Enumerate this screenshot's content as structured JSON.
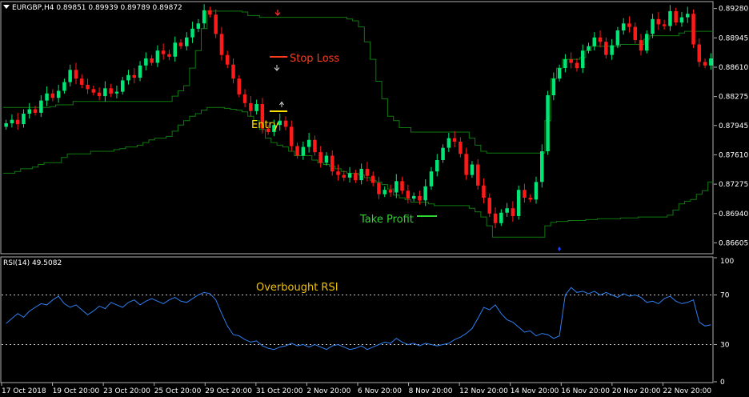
{
  "header": {
    "symbol_line": "EURGBP,H4  0.89851 0.89939 0.89789 0.89872",
    "rsi_label": "RSI(14) 49.5082"
  },
  "annotations": {
    "stop_loss": "Stop Loss",
    "entry": "Entry",
    "take_profit": "Take Profit",
    "overbought": "Overbought RSI"
  },
  "colors": {
    "background": "#000000",
    "bull": "#00e676",
    "bear": "#ff1a1a",
    "channel": "#0f7a0f",
    "rsi": "#2f7ff0",
    "stop_loss": "#ff3b1e",
    "entry": "#ffe100",
    "take_profit": "#2fd42f",
    "overbought": "#f2c200"
  },
  "chart_data": [
    {
      "type": "candlestick",
      "symbol": "EURGBP",
      "timeframe": "H4",
      "ylim": [
        0.8649,
        0.8935
      ],
      "yticks": [
        "0.89280",
        "0.88945",
        "0.88610",
        "0.88275",
        "0.87945",
        "0.87610",
        "0.87275",
        "0.86940",
        "0.86605"
      ],
      "xticks": [
        "17 Oct 2018",
        "19 Oct 20:00",
        "23 Oct 20:00",
        "25 Oct 20:00",
        "29 Oct 20:00",
        "31 Oct 20:00",
        "2 Nov 20:00",
        "6 Nov 20:00",
        "8 Nov 20:00",
        "12 Nov 20:00",
        "14 Nov 20:00",
        "16 Nov 20:00",
        "20 Nov 20:00",
        "22 Nov 20:00"
      ],
      "close": [
        0.8797,
        0.8801,
        0.8796,
        0.8808,
        0.8813,
        0.8809,
        0.8823,
        0.8831,
        0.8826,
        0.8834,
        0.8844,
        0.8858,
        0.8848,
        0.8841,
        0.8836,
        0.8832,
        0.8828,
        0.8837,
        0.8831,
        0.8833,
        0.8846,
        0.8852,
        0.8849,
        0.8863,
        0.8871,
        0.8866,
        0.888,
        0.8876,
        0.8873,
        0.8889,
        0.8885,
        0.8895,
        0.8905,
        0.8911,
        0.8926,
        0.8921,
        0.8899,
        0.8875,
        0.8864,
        0.8848,
        0.883,
        0.882,
        0.8811,
        0.8819,
        0.8791,
        0.8787,
        0.8795,
        0.88,
        0.8793,
        0.8771,
        0.876,
        0.877,
        0.8778,
        0.8764,
        0.8752,
        0.876,
        0.8742,
        0.8738,
        0.8735,
        0.874,
        0.8732,
        0.8745,
        0.8737,
        0.8729,
        0.8716,
        0.8721,
        0.8718,
        0.8731,
        0.872,
        0.8711,
        0.8714,
        0.8709,
        0.8725,
        0.8742,
        0.8755,
        0.8769,
        0.878,
        0.8776,
        0.8762,
        0.8738,
        0.875,
        0.8726,
        0.8712,
        0.8694,
        0.8683,
        0.8695,
        0.87,
        0.8691,
        0.8721,
        0.8712,
        0.871,
        0.873,
        0.8765,
        0.8829,
        0.8848,
        0.886,
        0.887,
        0.8866,
        0.886,
        0.888,
        0.8885,
        0.8895,
        0.889,
        0.8875,
        0.8886,
        0.8903,
        0.8911,
        0.8907,
        0.8892,
        0.888,
        0.8899,
        0.8916,
        0.891,
        0.8908,
        0.8925,
        0.8912,
        0.8918,
        0.8922,
        0.8887,
        0.8867,
        0.8863,
        0.8871
      ],
      "channel_upper": [
        0.8815,
        0.8815,
        0.8815,
        0.8815,
        0.8815,
        0.8815,
        0.8815,
        0.8815,
        0.8816,
        0.8818,
        0.8818,
        0.8818,
        0.8822,
        0.8822,
        0.8822,
        0.8822,
        0.8822,
        0.8822,
        0.8822,
        0.8822,
        0.8822,
        0.8822,
        0.8822,
        0.8822,
        0.8822,
        0.8822,
        0.8822,
        0.8822,
        0.8822,
        0.8828,
        0.8834,
        0.884,
        0.886,
        0.888,
        0.8905,
        0.8925,
        0.8925,
        0.8925,
        0.8925,
        0.8925,
        0.8925,
        0.8924,
        0.892,
        0.892,
        0.8918,
        0.8918,
        0.8918,
        0.8918,
        0.8918,
        0.8918,
        0.8918,
        0.8918,
        0.8918,
        0.8918,
        0.8918,
        0.8918,
        0.8918,
        0.8918,
        0.8918,
        0.8916,
        0.8914,
        0.8907,
        0.889,
        0.887,
        0.8845,
        0.8825,
        0.8805,
        0.88,
        0.8792,
        0.8792,
        0.8787,
        0.8787,
        0.8787,
        0.8787,
        0.8787,
        0.8787,
        0.8787,
        0.8787,
        0.8787,
        0.8787,
        0.878,
        0.8772,
        0.8765,
        0.8763,
        0.8763,
        0.8763,
        0.8763,
        0.8763,
        0.8763,
        0.8763,
        0.8763,
        0.8763,
        0.8763,
        0.88,
        0.8848,
        0.886,
        0.887,
        0.887,
        0.887,
        0.8872,
        0.888,
        0.8885,
        0.8885,
        0.8885,
        0.8885,
        0.8885,
        0.8887,
        0.8887,
        0.8887,
        0.8887,
        0.8893,
        0.8897,
        0.8897,
        0.8897,
        0.8897,
        0.8897,
        0.89,
        0.8902,
        0.8902,
        0.8902,
        0.8902,
        0.8902
      ],
      "channel_lower": [
        0.874,
        0.874,
        0.8742,
        0.8745,
        0.8745,
        0.8747,
        0.875,
        0.8752,
        0.8752,
        0.8752,
        0.8758,
        0.8762,
        0.8762,
        0.8762,
        0.8762,
        0.8765,
        0.8765,
        0.8765,
        0.8765,
        0.8767,
        0.8768,
        0.877,
        0.877,
        0.8772,
        0.8775,
        0.8778,
        0.878,
        0.878,
        0.8782,
        0.8788,
        0.8795,
        0.88,
        0.8805,
        0.8808,
        0.8812,
        0.8815,
        0.8815,
        0.8815,
        0.8814,
        0.8813,
        0.8812,
        0.881,
        0.8805,
        0.88,
        0.879,
        0.878,
        0.8775,
        0.8772,
        0.877,
        0.8765,
        0.876,
        0.876,
        0.876,
        0.8755,
        0.8752,
        0.875,
        0.8748,
        0.8745,
        0.8742,
        0.874,
        0.874,
        0.8738,
        0.8735,
        0.8732,
        0.873,
        0.8727,
        0.8722,
        0.8715,
        0.8712,
        0.871,
        0.8707,
        0.8707,
        0.8707,
        0.8705,
        0.8703,
        0.8703,
        0.8703,
        0.8703,
        0.8703,
        0.8703,
        0.87,
        0.8696,
        0.869,
        0.868,
        0.8667,
        0.8667,
        0.8667,
        0.8667,
        0.8667,
        0.8667,
        0.8667,
        0.8667,
        0.8667,
        0.868,
        0.8684,
        0.8685,
        0.8685,
        0.8686,
        0.8686,
        0.8686,
        0.8687,
        0.8687,
        0.8688,
        0.8688,
        0.8688,
        0.8688,
        0.8689,
        0.8689,
        0.8689,
        0.869,
        0.869,
        0.869,
        0.869,
        0.869,
        0.8692,
        0.8698,
        0.8705,
        0.8708,
        0.871,
        0.8716,
        0.872,
        0.873
      ]
    },
    {
      "type": "line",
      "name": "RSI(14) 49.5082",
      "ylim": [
        0,
        100
      ],
      "yticks": [
        "100",
        "70",
        "30",
        "0"
      ],
      "levels": [
        70,
        30
      ],
      "values": [
        47,
        51,
        55,
        52,
        57,
        60,
        63,
        62,
        66,
        69,
        63,
        60,
        62,
        58,
        54,
        57,
        61,
        59,
        64,
        62,
        60,
        64,
        66,
        62,
        65,
        67,
        65,
        63,
        66,
        68,
        65,
        64,
        67,
        70,
        72,
        71,
        66,
        55,
        45,
        38,
        37,
        34,
        32,
        33,
        29,
        27,
        26,
        28,
        29,
        31,
        29,
        30,
        28,
        30,
        28,
        26,
        29,
        30,
        28,
        26,
        27,
        29,
        26,
        28,
        30,
        32,
        31,
        35,
        32,
        30,
        31,
        29,
        31,
        30,
        29,
        30,
        31,
        34,
        36,
        39,
        43,
        51,
        60,
        58,
        62,
        55,
        50,
        48,
        44,
        40,
        41,
        37,
        39,
        38,
        35,
        37,
        70,
        76,
        72,
        73,
        71,
        73,
        70,
        72,
        70,
        68,
        71,
        69,
        70,
        68,
        64,
        65,
        63,
        67,
        69,
        65,
        63,
        64,
        66,
        48,
        45,
        46
      ]
    }
  ]
}
